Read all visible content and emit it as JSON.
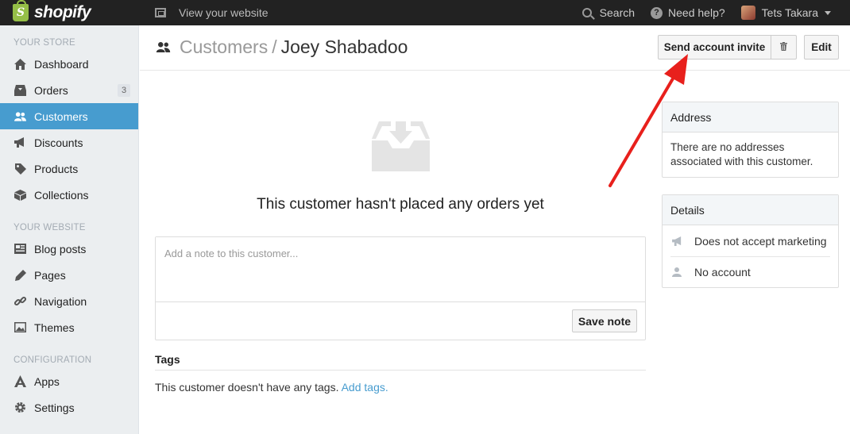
{
  "topbar": {
    "brand": "shopify",
    "view_site": "View your website",
    "search": "Search",
    "help": "Need help?",
    "user": "Tets Takara"
  },
  "sidebar": {
    "sections": [
      {
        "title": "YOUR STORE"
      },
      {
        "title": "YOUR WEBSITE"
      },
      {
        "title": "CONFIGURATION"
      }
    ],
    "items": [
      {
        "label": "Dashboard",
        "icon": "home-icon"
      },
      {
        "label": "Orders",
        "icon": "inbox-icon",
        "badge": "3"
      },
      {
        "label": "Customers",
        "icon": "customers-icon",
        "active": true
      },
      {
        "label": "Discounts",
        "icon": "megaphone-icon"
      },
      {
        "label": "Products",
        "icon": "tag-icon"
      },
      {
        "label": "Collections",
        "icon": "box-icon"
      },
      {
        "label": "Blog posts",
        "icon": "blog-icon"
      },
      {
        "label": "Pages",
        "icon": "pencil-icon"
      },
      {
        "label": "Navigation",
        "icon": "link-icon"
      },
      {
        "label": "Themes",
        "icon": "image-icon"
      },
      {
        "label": "Apps",
        "icon": "apps-icon"
      },
      {
        "label": "Settings",
        "icon": "gear-icon"
      }
    ]
  },
  "header": {
    "parent": "Customers",
    "separator": "/",
    "title": "Joey Shabadoo",
    "invite_label": "Send account invite",
    "trash_glyph": "🗑",
    "edit_label": "Edit"
  },
  "main": {
    "empty_message": "This customer hasn't placed any orders yet",
    "note_placeholder": "Add a note to this customer...",
    "save_label": "Save note",
    "tags_label": "Tags",
    "tags_text": "This customer doesn't have any tags.",
    "tags_link": "Add tags."
  },
  "address_card": {
    "title": "Address",
    "text": "There are no addresses associated with this customer."
  },
  "details_card": {
    "title": "Details",
    "rows": [
      {
        "label": "Does not accept marketing",
        "icon": "megaphone-icon"
      },
      {
        "label": "No account",
        "icon": "person-icon"
      }
    ]
  },
  "colors": {
    "accent": "#479ccf",
    "topbar": "#222222",
    "sidebar": "#ebeef0",
    "annotation_arrow": "#e8201c",
    "brand_green": "#95bf47"
  }
}
